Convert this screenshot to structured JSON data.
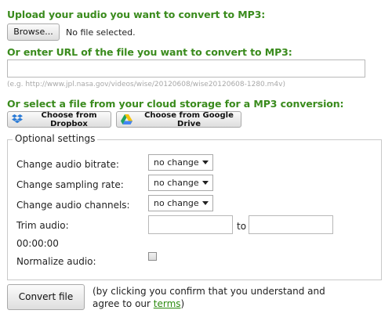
{
  "colors": {
    "heading": "#3a8b1d",
    "link": "#2d8a0f"
  },
  "upload": {
    "heading": "Upload your audio you want to convert to MP3:",
    "browse_label": "Browse...",
    "file_status": "No file selected."
  },
  "url_section": {
    "heading": "Or enter URL of the file you want to convert to MP3:",
    "url_value": "",
    "example": "(e.g. http://www.jpl.nasa.gov/videos/wise/20120608/wise20120608-1280.m4v)"
  },
  "cloud": {
    "heading": "Or select a file from your cloud storage for a MP3 conversion:",
    "dropbox_label": "Choose from Dropbox",
    "dropbox_icon": "dropbox-icon",
    "gdrive_label": "Choose from Google Drive",
    "gdrive_icon": "google-drive-icon"
  },
  "settings": {
    "legend": "Optional settings",
    "bitrate_label": "Change audio bitrate:",
    "bitrate_value": "no change",
    "sampling_label": "Change sampling rate:",
    "sampling_value": "no change",
    "channels_label": "Change audio channels:",
    "channels_value": "no change",
    "trim_label": "Trim audio:",
    "trim_from": "",
    "trim_to_label": "to",
    "trim_to": "",
    "trim_placeholder": "00:00:00",
    "normalize_label": "Normalize audio:",
    "normalize_checked": false
  },
  "footer": {
    "convert_label": "Convert file",
    "disclaimer_line1": "(by clicking you confirm that you understand and",
    "disclaimer_line2_prefix": "agree to our ",
    "terms_link": "terms",
    "disclaimer_line2_suffix": ")"
  }
}
